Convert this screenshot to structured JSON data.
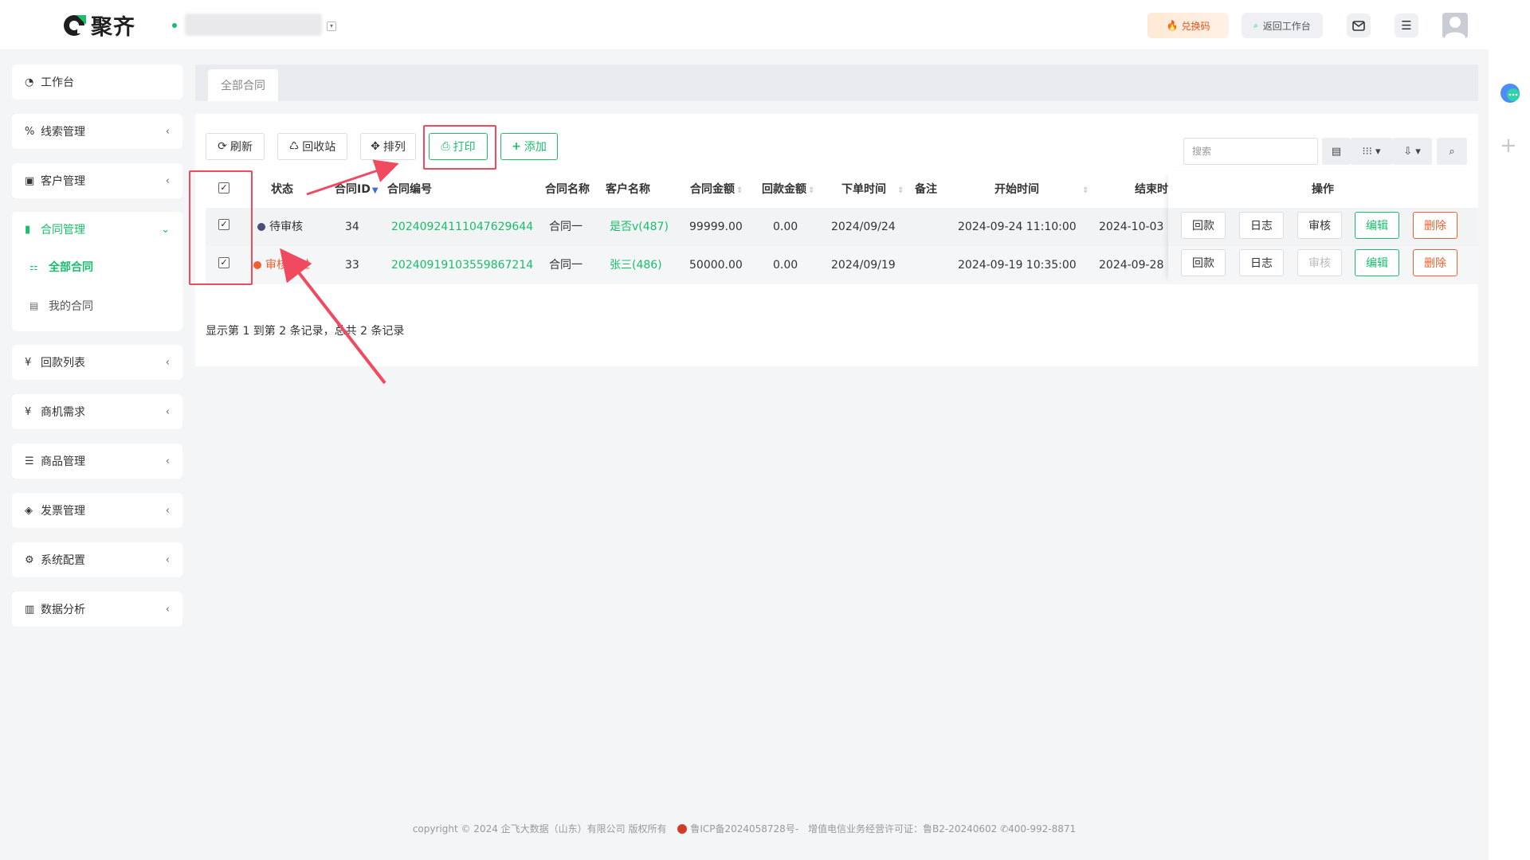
{
  "brand": {
    "name": "聚齐",
    "accent": "#19be6b"
  },
  "header": {
    "org_name": "",
    "redeem_label": "兑换码",
    "back_label": "返回工作台"
  },
  "sidebar": {
    "items": [
      {
        "label": "工作台",
        "icon": "dashboard-icon",
        "arrow": ""
      },
      {
        "label": "线索管理",
        "icon": "link-icon",
        "arrow": "‹"
      },
      {
        "label": "客户管理",
        "icon": "id-card-icon",
        "arrow": "‹"
      },
      {
        "label": "合同管理",
        "icon": "bookmark-icon",
        "arrow": "⌄"
      },
      {
        "label": "回款列表",
        "icon": "yen-icon",
        "arrow": "‹"
      },
      {
        "label": "商机需求",
        "icon": "yen-icon",
        "arrow": "‹"
      },
      {
        "label": "商品管理",
        "icon": "list-icon",
        "arrow": "‹"
      },
      {
        "label": "发票管理",
        "icon": "ticket-icon",
        "arrow": "‹"
      },
      {
        "label": "系统配置",
        "icon": "gears-icon",
        "arrow": "‹"
      },
      {
        "label": "数据分析",
        "icon": "bar-chart-icon",
        "arrow": "‹"
      }
    ],
    "sub_items": [
      {
        "label": "全部合同"
      },
      {
        "label": "我的合同"
      }
    ]
  },
  "tabs": [
    {
      "label": "全部合同"
    }
  ],
  "toolbar": {
    "refresh": "刷新",
    "recycle": "回收站",
    "sort": "排列",
    "print": "打印",
    "add": "添加",
    "search_placeholder": "搜索"
  },
  "table": {
    "columns": [
      "状态",
      "合同ID",
      "合同编号",
      "合同名称",
      "客户名称",
      "合同金额",
      "回款金额",
      "下单时间",
      "备注",
      "开始时间",
      "结束时",
      "操作"
    ],
    "rows": [
      {
        "status": "待审核",
        "status_color": "#4a4f7a",
        "id": "34",
        "no": "20240924111047629644",
        "name": "合同一",
        "customer": "是否v(487)",
        "amount": "99999.00",
        "paid": "0.00",
        "order_date": "2024/09/24",
        "remark": "",
        "start": "2024-09-24 11:10:00",
        "end": "2024-10-03",
        "actions": [
          "回款",
          "日志",
          "审核",
          "编辑",
          "删除"
        ],
        "review_disabled": false
      },
      {
        "status": "审核通过",
        "status_color": "#f0602d",
        "id": "33",
        "no": "20240919103559867214",
        "name": "合同一",
        "customer": "张三(486)",
        "amount": "50000.00",
        "paid": "0.00",
        "order_date": "2024/09/19",
        "remark": "",
        "start": "2024-09-19 10:35:00",
        "end": "2024-09-28",
        "actions": [
          "回款",
          "日志",
          "审核",
          "编辑",
          "删除"
        ],
        "review_disabled": true
      }
    ]
  },
  "pager": {
    "text": "显示第 1 到第 2 条记录，总共 2 条记录"
  },
  "footer": {
    "copyright": "copyright © 2024 企飞大数据（山东）有限公司 版权所有",
    "icp": "鲁ICP备2024058728号-",
    "license": "增值电信业务经营许可证：鲁B2-20240602",
    "phone": "400-992-8871"
  }
}
